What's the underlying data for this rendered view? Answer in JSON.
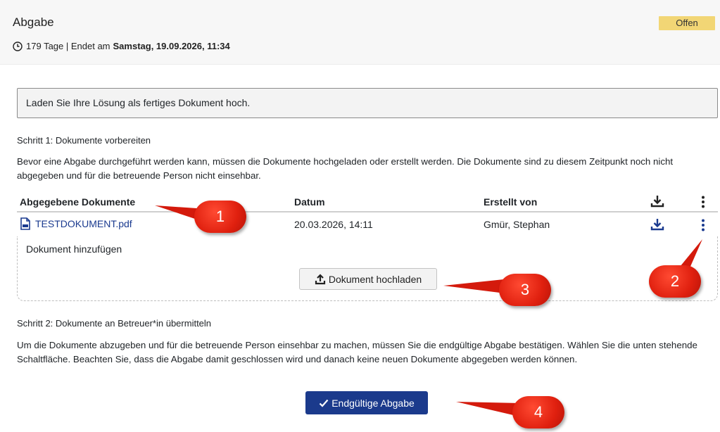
{
  "header": {
    "title": "Abgabe",
    "status_badge": "Offen",
    "deadline_prefix": "179 Tage | Endet am",
    "deadline_date": "Samstag, 19.09.2026, 11:34"
  },
  "info_text": "Laden Sie Ihre Lösung als fertiges Dokument hoch.",
  "step1": {
    "title": "Schritt 1: Dokumente vorbereiten",
    "description": "Bevor eine Abgabe durchgeführt werden kann, müssen die Dokumente hochgeladen oder erstellt werden. Die Dokumente sind zu diesem Zeitpunkt noch nicht abgegeben und für die betreuende Person nicht einsehbar."
  },
  "documents_table": {
    "headers": {
      "name": "Abgegebene Dokumente",
      "date": "Datum",
      "created_by": "Erstellt von"
    },
    "header_icons": [
      "download-icon",
      "more-vertical-icon"
    ],
    "rows": [
      {
        "name": "TESTDOKUMENT.pdf",
        "date": "20.03.2026, 14:11",
        "created_by": "Gmür, Stephan",
        "icon": "pdf-file-icon"
      }
    ]
  },
  "add_document": {
    "label": "Dokument hinzufügen",
    "upload_button": "Dokument hochladen"
  },
  "step2": {
    "title": "Schritt 2: Dokumente an Betreuer*in übermitteln",
    "description": "Um die Dokumente abzugeben und für die betreuende Person einsehbar zu machen, müssen Sie die endgültige Abgabe bestätigen. Wählen Sie die unten stehende Schaltfläche. Beachten Sie, dass die Abgabe damit geschlossen wird und danach keine neuen Dokumente abgegeben werden können."
  },
  "submit_button": "Endgültige Abgabe",
  "annotations": [
    "1",
    "2",
    "3",
    "4"
  ],
  "colors": {
    "accent": "#1b3a8c",
    "badge": "#f2d675",
    "annotation_red": "#e0200f"
  }
}
